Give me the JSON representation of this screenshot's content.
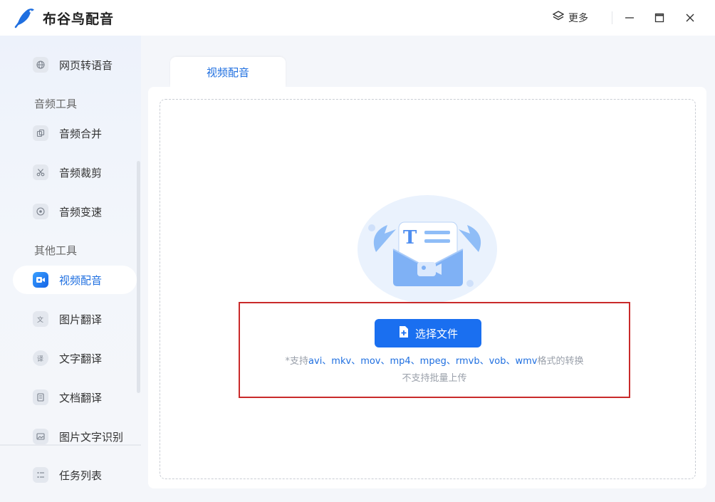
{
  "app": {
    "title": "布谷鸟配音",
    "logo_icon": "bird-pen-logo-icon"
  },
  "titlebar": {
    "more_label": "更多",
    "more_icon": "layers-icon",
    "minimize_icon": "minimize-icon",
    "maximize_icon": "maximize-icon",
    "close_icon": "close-icon"
  },
  "sidebar": {
    "top_items": [
      {
        "label": "网页转语音",
        "icon": "globe-icon"
      }
    ],
    "audio_section": "音频工具",
    "audio_items": [
      {
        "label": "音频合并",
        "icon": "merge-icon"
      },
      {
        "label": "音频裁剪",
        "icon": "scissors-icon"
      },
      {
        "label": "音频变速",
        "icon": "speed-dial-icon"
      }
    ],
    "other_section": "其他工具",
    "other_items": [
      {
        "label": "视频配音",
        "icon": "video-mic-icon",
        "active": true
      },
      {
        "label": "图片翻译",
        "icon": "image-translate-icon"
      },
      {
        "label": "文字翻译",
        "icon": "chat-translate-icon"
      },
      {
        "label": "文档翻译",
        "icon": "document-translate-icon"
      },
      {
        "label": "图片文字识别",
        "icon": "image-ocr-icon"
      }
    ],
    "task_list": {
      "label": "任务列表",
      "icon": "task-list-icon"
    }
  },
  "main": {
    "tab_label": "视频配音",
    "select_button": "选择文件",
    "select_icon": "file-plus-icon",
    "support_prefix": "*支持",
    "support_formats": "avi、mkv、mov、mp4、mpeg、rmvb、vob、wmv",
    "support_suffix": "格式的转换",
    "batch_note": "不支持批量上传",
    "accent_color": "#1a6ff0",
    "highlight_color": "#c92a2a"
  }
}
